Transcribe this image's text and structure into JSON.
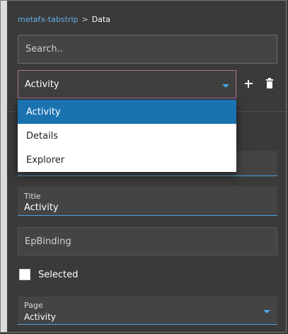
{
  "breadcrumb": {
    "link": "metafx-tabstrip",
    "separator": ">",
    "current": "Data"
  },
  "search": {
    "placeholder": "Search..",
    "value": ""
  },
  "selector": {
    "selected": "Activity",
    "options": [
      "Activity",
      "Details",
      "Explorer"
    ]
  },
  "toolbar": {
    "add_icon": "plus-icon",
    "delete_icon": "trash-icon"
  },
  "form": {
    "title": {
      "label": "Title",
      "value": "Activity"
    },
    "epbinding": {
      "placeholder": "EpBinding",
      "value": ""
    },
    "selected": {
      "label": "Selected",
      "checked": false
    },
    "page": {
      "label": "Page",
      "value": "Activity"
    }
  },
  "colors": {
    "accent": "#4aa3e0",
    "link": "#62b3ea",
    "focus_border": "#b4719d",
    "selected_option": "#1a72b0",
    "background": "#3a3a3a"
  }
}
